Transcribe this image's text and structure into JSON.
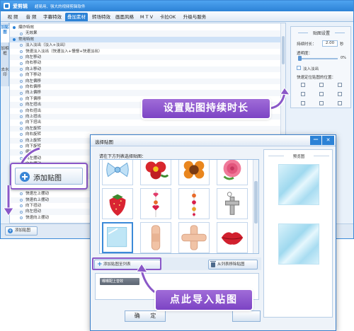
{
  "app": {
    "title": "爱剪辑",
    "slogan": "超易用、强大的视频剪辑软件"
  },
  "menu": {
    "tabs": [
      {
        "label": "视 频"
      },
      {
        "label": "音 频"
      },
      {
        "label": "字幕特效"
      },
      {
        "label": "叠加素材"
      },
      {
        "label": "转场特效"
      },
      {
        "label": "画面风格"
      },
      {
        "label": "M T V"
      },
      {
        "label": "卡拉OK"
      },
      {
        "label": "升级与服务"
      }
    ],
    "active_index": 3
  },
  "side_tabs": [
    {
      "label": "加贴图"
    },
    {
      "label": "加相框"
    },
    {
      "label": "去水印"
    }
  ],
  "effects_tree": {
    "rows": [
      {
        "label": "爆炸特效",
        "level": 0
      },
      {
        "label": "无效果",
        "level": 1
      },
      {
        "label": "常用特效",
        "level": 0
      },
      {
        "label": "淡入淡出（淡入+淡出）",
        "level": 1
      },
      {
        "label": "快速淡入淡出（快速淡入+慢慢+快速淡出）",
        "level": 1
      },
      {
        "label": "向左移动",
        "level": 1
      },
      {
        "label": "向右移动",
        "level": 1
      },
      {
        "label": "向上移动",
        "level": 1
      },
      {
        "label": "向下移动",
        "level": 1
      },
      {
        "label": "向左偏移",
        "level": 1
      },
      {
        "label": "向右偏移",
        "level": 1
      },
      {
        "label": "向上偏移",
        "level": 1
      },
      {
        "label": "向下偏移",
        "level": 1
      },
      {
        "label": "向左扭出",
        "level": 1
      },
      {
        "label": "向右扭出",
        "level": 1
      },
      {
        "label": "向上扭出",
        "level": 1
      },
      {
        "label": "向下扭出",
        "level": 1
      },
      {
        "label": "向左旋转",
        "level": 1
      },
      {
        "label": "向右旋转",
        "level": 1
      },
      {
        "label": "向上旋转",
        "level": 1
      },
      {
        "label": "向下旋转",
        "level": 1
      },
      {
        "label": "缩放",
        "level": 1
      },
      {
        "label": "向左摆动",
        "level": 1
      },
      {
        "label": "向右摆动",
        "level": 1
      },
      {
        "label": "向上摆动",
        "level": 1
      },
      {
        "label": "向下摆动",
        "level": 1
      },
      {
        "label": "快速向上摆动",
        "level": 1
      },
      {
        "label": "快速向下摆动",
        "level": 1
      },
      {
        "label": "快速左上摆动",
        "level": 1
      },
      {
        "label": "快速右上摆动",
        "level": 1
      },
      {
        "label": "向下扭动",
        "level": 1
      },
      {
        "label": "向左扭动",
        "level": 1
      },
      {
        "label": "快速向上摆动",
        "level": 1
      }
    ],
    "selected_index": 2
  },
  "main_bottom": {
    "add_sticker_label": "添加贴图"
  },
  "settings": {
    "title": "贴图设置",
    "duration_label": "持续时长：",
    "duration_value": "2.00",
    "duration_unit": "秒",
    "opacity_label": "透明度：",
    "opacity_value": "0%",
    "opacity_fraction": 0.0,
    "fade_label": "淡入淡出",
    "position_label": "快速定位贴图的位置："
  },
  "callouts": {
    "duration": "设置贴图持续时长",
    "add_sticker": "添加贴图",
    "import": "点此导入贴图"
  },
  "dialog": {
    "title": "选择贴图",
    "minimize_label": "—",
    "close_label": "✕",
    "prompt": "请在下方列表选择贴图：",
    "stickers": [
      {
        "name": "bow-icon"
      },
      {
        "name": "red-flower-icon"
      },
      {
        "name": "orange-flower-icon"
      },
      {
        "name": "rose-icon"
      },
      {
        "name": "strawberry-icon"
      },
      {
        "name": "heart-beads-icon"
      },
      {
        "name": "bead-string-icon"
      },
      {
        "name": "cross-pendant-icon"
      },
      {
        "name": "glass-icon"
      },
      {
        "name": "bandage-icon"
      },
      {
        "name": "cross-bandage-icon"
      },
      {
        "name": "lips-icon"
      }
    ],
    "selected_sticker_index": 8,
    "add_to_list_label": "添加贴图至列表",
    "remove_label": "从列表移除贴图",
    "list_chip_label": "曝曝配上音效",
    "preview_title": "预览图",
    "ok_label": "确 定"
  }
}
